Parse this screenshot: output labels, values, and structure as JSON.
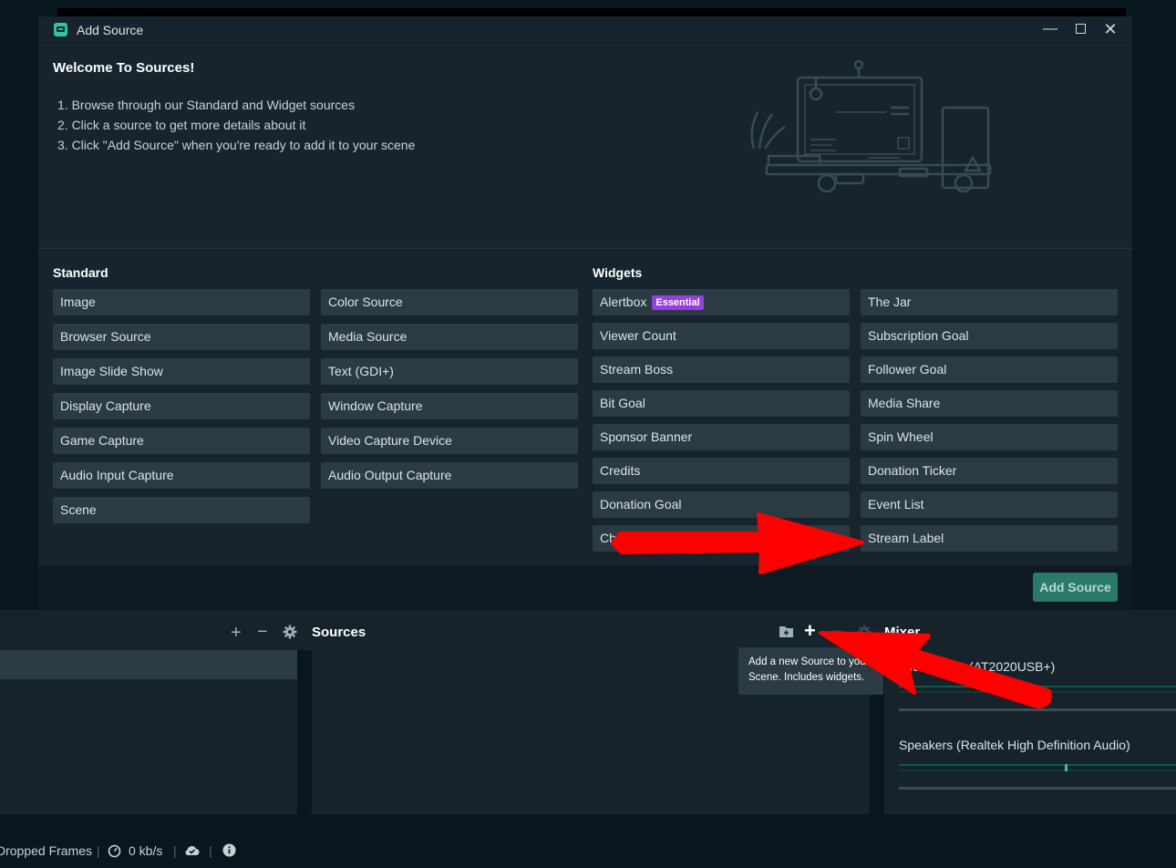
{
  "dialog": {
    "title": "Add Source",
    "controls": {
      "minimize": "—",
      "close": "✕"
    },
    "welcome_title": "Welcome To Sources!",
    "steps": [
      "1. Browse through our Standard and Widget sources",
      "2. Click a source to get more details about it",
      "3. Click \"Add Source\" when you're ready to add it to your scene"
    ],
    "standard": {
      "title": "Standard",
      "col1": [
        "Image",
        "Browser Source",
        "Image Slide Show",
        "Display Capture",
        "Game Capture",
        "Audio Input Capture",
        "Scene"
      ],
      "col2": [
        "Color Source",
        "Media Source",
        "Text (GDI+)",
        "Window Capture",
        "Video Capture Device",
        "Audio Output Capture"
      ]
    },
    "widgets": {
      "title": "Widgets",
      "col1": [
        "Alertbox",
        "Viewer Count",
        "Stream Boss",
        "Bit Goal",
        "Sponsor Banner",
        "Credits",
        "Donation Goal",
        "Chatbox"
      ],
      "col1_badge": "Essential",
      "col2": [
        "The Jar",
        "Subscription Goal",
        "Follower Goal",
        "Media Share",
        "Spin Wheel",
        "Donation Ticker",
        "Event List",
        "Stream Label"
      ]
    },
    "add_button": "Add Source"
  },
  "editor": {
    "scenes_controls": {
      "add": "+",
      "remove": "−"
    },
    "sources_title": "Sources",
    "sources_controls": {
      "add": "+",
      "remove": "−"
    },
    "mixer_title": "Mixer",
    "tooltip": [
      "Add a new Source to your",
      "Scene. Includes widgets."
    ],
    "mixer_items": [
      "Microphone (AT2020USB+)",
      "Speakers (Realtek High Definition Audio)"
    ]
  },
  "status": {
    "dropped_frames": "Dropped Frames",
    "bitrate": "0 kb/s",
    "separator": "|"
  },
  "colors": {
    "accent": "#31c3a2",
    "badge": "#953fe0",
    "arrow": "#ff0000"
  }
}
